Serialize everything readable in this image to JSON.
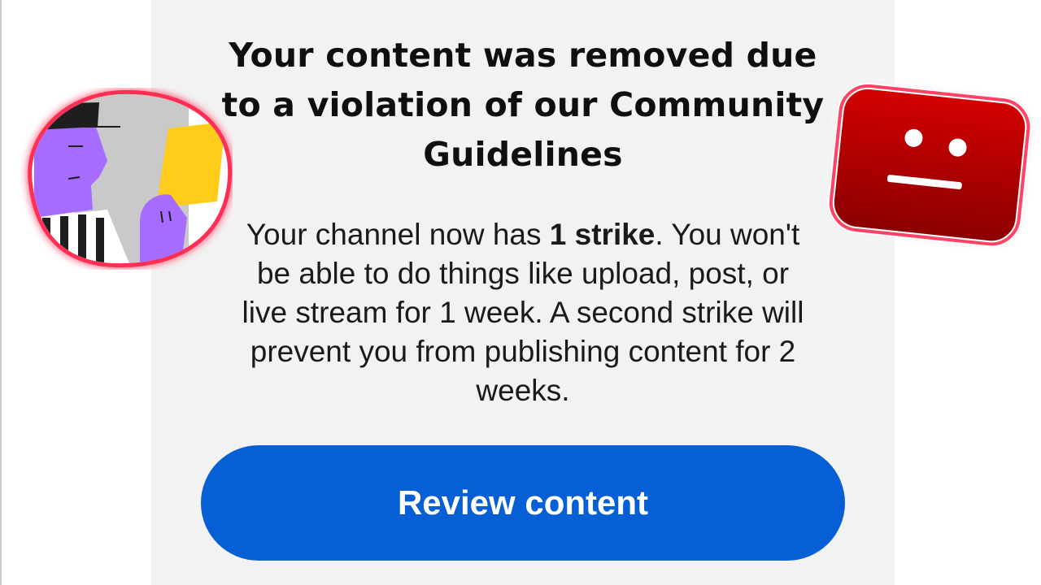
{
  "dialog": {
    "title_lines": [
      "Your content was removed due",
      "to a violation of our Community",
      "Guidelines"
    ],
    "body": {
      "line1_pre": "Your channel now has ",
      "line1_bold": "1 strike",
      "line1_post": ". You won't",
      "line2": "be able to do things like upload, post, or",
      "line3": "live stream for 1 week. A second strike will",
      "line4": "prevent you from publishing content for 2",
      "line5": "weeks."
    },
    "review_button_label": "Review content"
  },
  "colors": {
    "card_background": "#f2f2f2",
    "button_blue": "#065fd4",
    "error_red": "#b80000",
    "glow": "#ff2d55",
    "card_yellow": "#ffcc1a",
    "referee_purple": "#a66cff"
  },
  "icons": {
    "left": "referee-yellow-card-icon",
    "right": "sad-play-button-icon"
  }
}
